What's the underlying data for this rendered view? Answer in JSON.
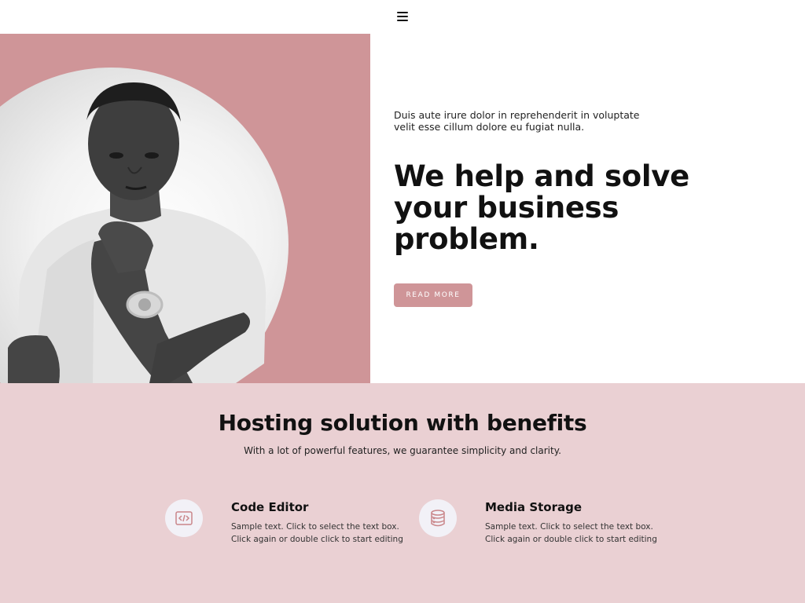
{
  "header": {
    "menu_icon": "hamburger-menu-icon"
  },
  "hero": {
    "subtitle": "Duis aute irure dolor in reprehenderit in voluptate velit esse cillum dolore eu fugiat nulla.",
    "title": "We help and solve your business problem.",
    "button_label": "READ MORE",
    "accent_color": "#cf9598"
  },
  "features": {
    "title": "Hosting solution with benefits",
    "subtitle": "With a lot of powerful features, we guarantee simplicity and clarity.",
    "background_color": "#ead0d3",
    "items": [
      {
        "icon": "code-icon",
        "title": "Code Editor",
        "text": "Sample text. Click to select the text box. Click again or double click to start editing"
      },
      {
        "icon": "database-icon",
        "title": "Media Storage",
        "text": "Sample text. Click to select the text box. Click again or double click to start editing"
      }
    ]
  }
}
